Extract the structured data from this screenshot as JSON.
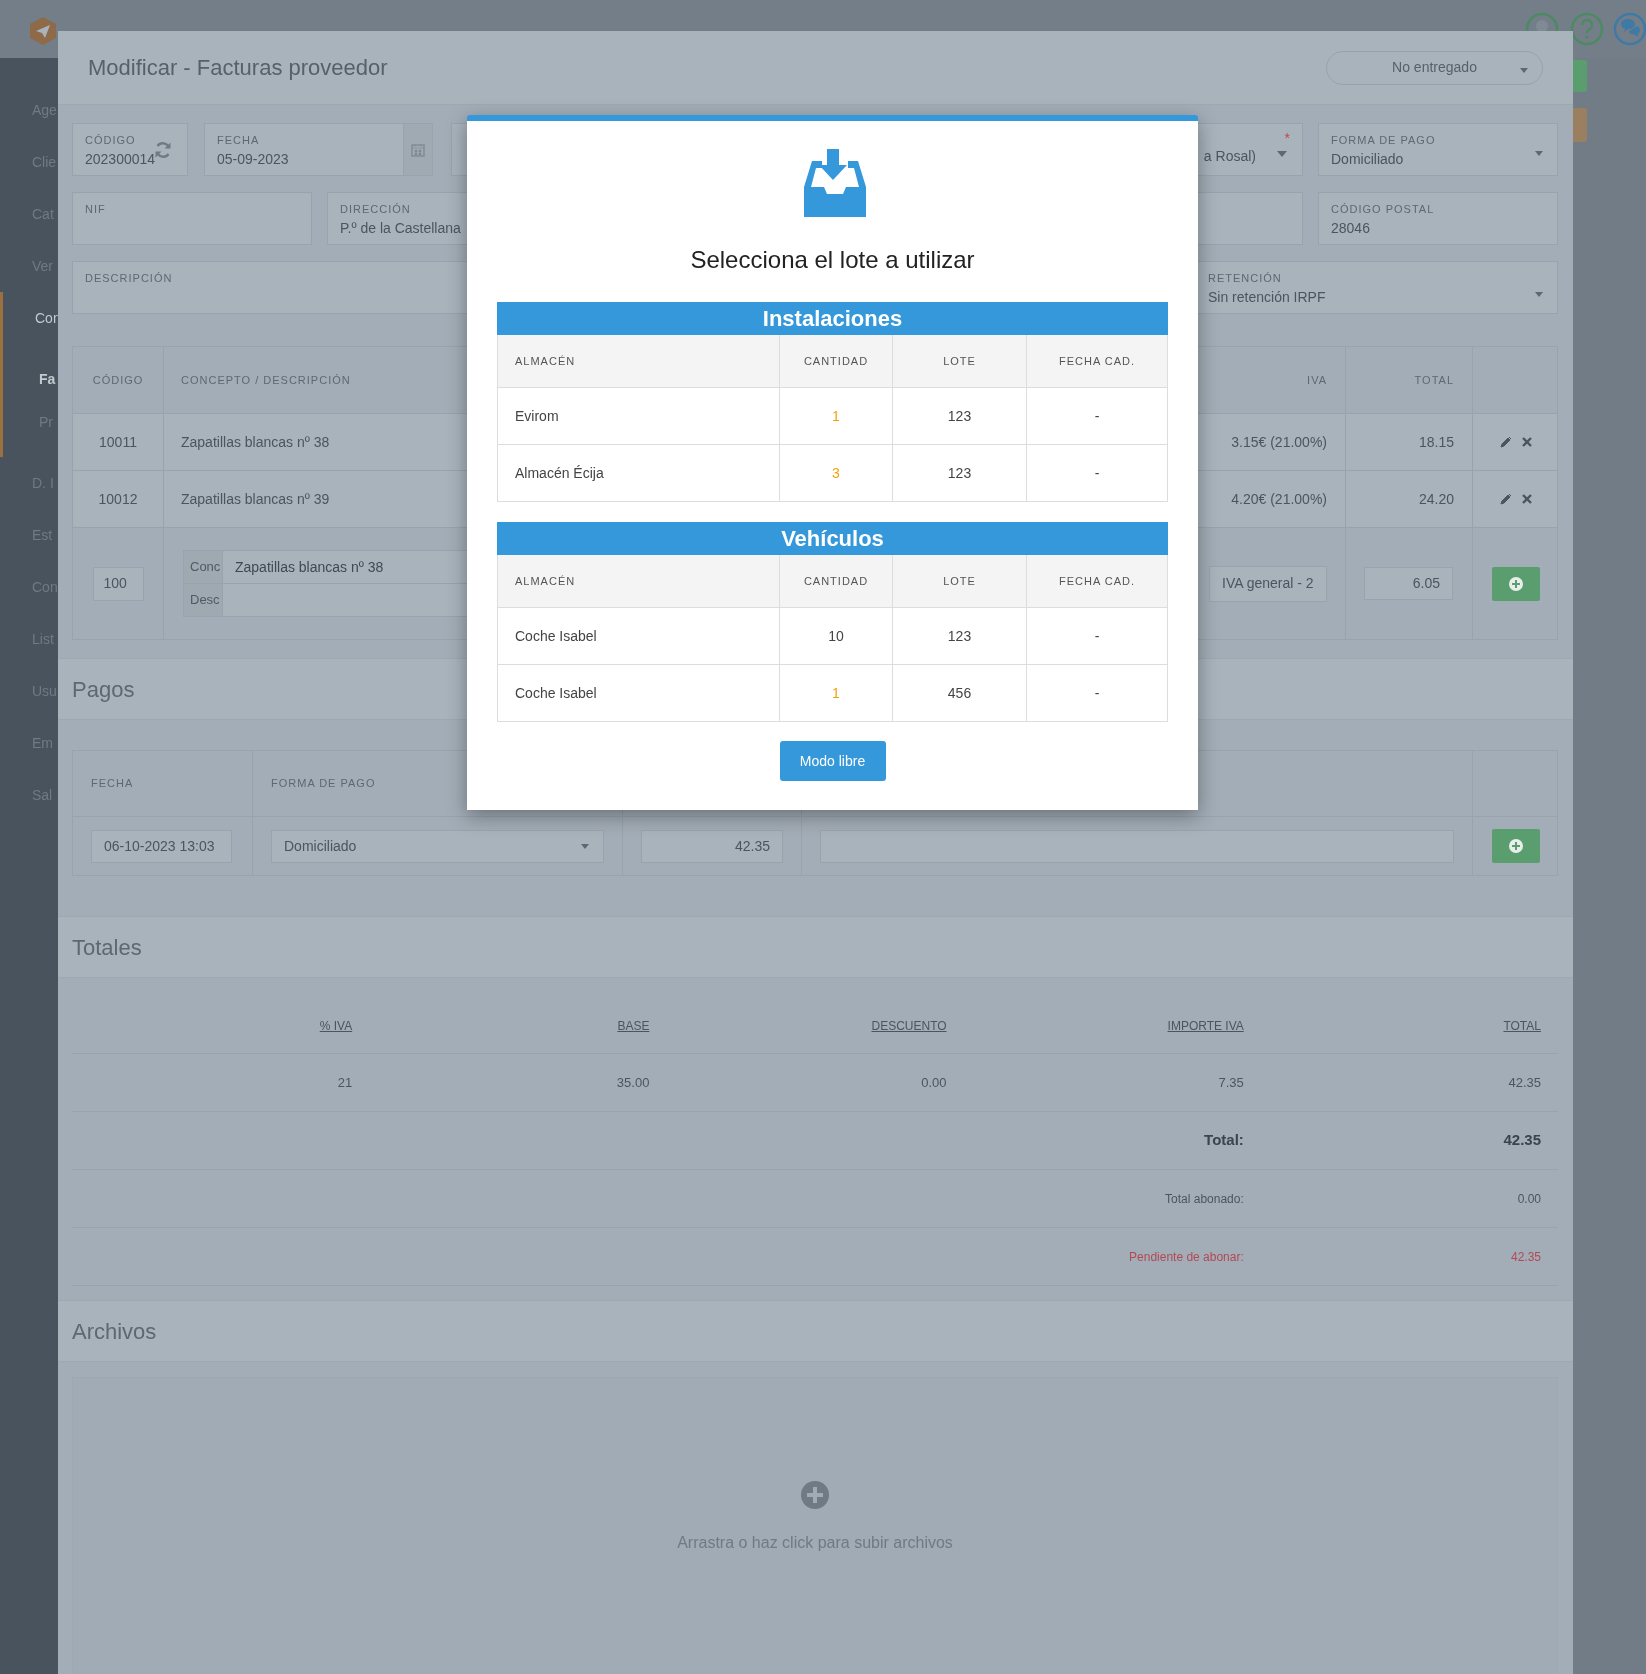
{
  "sidebar": {
    "items": [
      {
        "label": "Age",
        "selected": false
      },
      {
        "label": "Clie",
        "selected": false
      },
      {
        "label": "Cat",
        "selected": false
      },
      {
        "label": "Ver",
        "selected": false
      },
      {
        "label": "Con",
        "selected": true,
        "children": [
          {
            "label": "Fa",
            "selected": true
          },
          {
            "label": "Pr",
            "selected": false
          }
        ]
      },
      {
        "label": "D. I",
        "selected": false
      },
      {
        "label": "Est",
        "selected": false
      },
      {
        "label": "Con",
        "selected": false
      },
      {
        "label": "List",
        "selected": false
      },
      {
        "label": "Usu",
        "selected": false
      },
      {
        "label": "Em",
        "selected": false
      },
      {
        "label": "Sal",
        "selected": false
      }
    ]
  },
  "panel": {
    "title": "Modificar - Facturas proveedor",
    "status_select": "No entregado",
    "fields": {
      "code": {
        "label": "CÓDIGO",
        "value": "202300014"
      },
      "date": {
        "label": "FECHA",
        "value": "05-09-2023"
      },
      "supplier": {
        "value": "a Rosal)",
        "required_mark": "*"
      },
      "payment_method": {
        "label": "FORMA DE PAGO",
        "value": "Domiciliado"
      },
      "nif": {
        "label": "NIF"
      },
      "address": {
        "label": "DIRECCIÓN",
        "value": "P.º de la Castellana"
      },
      "postal_code": {
        "label": "CÓDIGO POSTAL",
        "value": "28046"
      },
      "description": {
        "label": "DESCRIPCIÓN"
      },
      "retention": {
        "label": "RETENCIÓN",
        "value": "Sin retención IRPF"
      }
    },
    "lines": {
      "columns": [
        "CÓDIGO",
        "CONCEPTO / DESCRIPCIÓN",
        "IVA",
        "TOTAL"
      ],
      "rows": [
        {
          "code": "10011",
          "concept": "Zapatillas blancas nº 38",
          "iva": "3.15€ (21.00%)",
          "total": "18.15"
        },
        {
          "code": "10012",
          "concept": "Zapatillas blancas nº 39",
          "iva": "4.20€ (21.00%)",
          "total": "24.20"
        }
      ],
      "edit_row": {
        "code": "100",
        "concept_addon": "Conc",
        "concept": "Zapatillas blancas nº 38",
        "description_addon": "Desc",
        "iva": "IVA general - 2",
        "total": "6.05"
      }
    },
    "payments": {
      "title": "Pagos",
      "columns": [
        "FECHA",
        "FORMA DE PAGO"
      ],
      "row": {
        "date": "06-10-2023 13:03",
        "method": "Domiciliado",
        "amount": "42.35"
      }
    },
    "totals": {
      "title": "Totales",
      "columns": [
        "% IVA",
        "BASE",
        "DESCUENTO",
        "IMPORTE IVA",
        "TOTAL"
      ],
      "rows": [
        [
          "21",
          "35.00",
          "0.00",
          "7.35",
          "42.35"
        ]
      ],
      "summary": [
        {
          "kind": "total",
          "label": "Total:",
          "value": "42.35"
        },
        {
          "kind": "paid",
          "label": "Total abonado:",
          "value": "0.00"
        },
        {
          "kind": "pending",
          "label": "Pendiente de abonar:",
          "value": "42.35"
        }
      ]
    },
    "files": {
      "title": "Archivos",
      "hint": "Arrastra o haz click para subir archivos"
    }
  },
  "modal": {
    "title": "Selecciona el lote a utilizar",
    "groups": [
      {
        "title": "Instalaciones",
        "columns": [
          "ALMACÉN",
          "CANTIDAD",
          "LOTE",
          "FECHA CAD."
        ],
        "rows": [
          {
            "warehouse": "Evirom",
            "quantity": "1",
            "warning": true,
            "lot": "123",
            "expiry": "-"
          },
          {
            "warehouse": "Almacén Écija",
            "quantity": "3",
            "warning": true,
            "lot": "123",
            "expiry": "-"
          }
        ]
      },
      {
        "title": "Vehículos",
        "columns": [
          "ALMACÉN",
          "CANTIDAD",
          "LOTE",
          "FECHA CAD."
        ],
        "rows": [
          {
            "warehouse": "Coche Isabel",
            "quantity": "10",
            "warning": false,
            "lot": "123",
            "expiry": "-"
          },
          {
            "warehouse": "Coche Isabel",
            "quantity": "1",
            "warning": true,
            "lot": "456",
            "expiry": "-"
          }
        ]
      }
    ],
    "button": "Modo libre"
  }
}
